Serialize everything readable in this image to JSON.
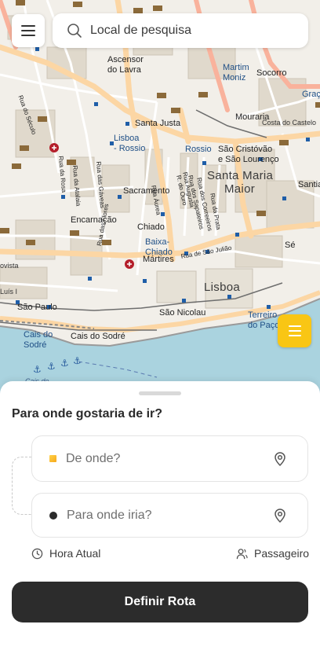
{
  "search": {
    "placeholder": "Local de pesquisa"
  },
  "icons": {
    "menu": "hamburger-icon",
    "search": "search-icon",
    "layers": "list-icon",
    "location_pin": "location-pin-icon",
    "clock": "clock-icon",
    "user": "user-icon"
  },
  "map": {
    "labels": {
      "lavra": "Lavra",
      "ascensor": "Ascensor",
      "do_lavra": "do Lavra",
      "martim": "Martim",
      "moniz": "Moniz",
      "socorro": "Socorro",
      "graca": "Graç",
      "mouraria": "Mouraria",
      "costa_castelo": "Costa do Castelo",
      "santa_justa": "Santa Justa",
      "lisboa_rossio": "Lisboa",
      "rossio": "- Rossio",
      "rossio2": "Rossio",
      "sao_cristovao": "São Cristóvão",
      "sao_lourenco": "e São Lourenço",
      "santa_maria": "Santa Maria",
      "maior": "Maior",
      "santiago": "Santia",
      "sacramento": "Sacramento",
      "encarnacao": "Encarnação",
      "chiado": "Chiado",
      "baixa": "Baixa-",
      "chiado2": "Chiado",
      "martires": "Mártires",
      "se": "Sé",
      "lisboa": "Lisboa",
      "sao_paulo": "São Paulo",
      "sao_nicolau": "São Nicolau",
      "terreiro": "Terreiro",
      "do_paco": "do Paço",
      "cais_sodre": "Cais do",
      "sodre": "Sodré",
      "cais_do_sodre": "Cais do Sodré",
      "rua_aurea": "Rua Áurea",
      "rua_augusta": "Rua Augusta",
      "rua_da_prata": "Rua da Prata",
      "rua_dos_correeiros": "Rua dos Correeiros",
      "rua_dos_sapateiros": "Rua dos Sapateiros",
      "rua_do_ouro": "R. do Ouro",
      "rua_das_gaveas": "Rua das Gáveas",
      "rua_da_rosa": "Rua da Rosa",
      "rua_do_seculo": "Rua do Século",
      "rua_das_flores": "Rua das Flores",
      "rua_sao_juliao": "Rua de São Julião",
      "rua_da_atalaia": "Rua da Atalaia",
      "luis": "Luís I",
      "avista": "ovista",
      "cais": "Cais de"
    }
  },
  "layers_button": {
    "icon": "list-icon"
  },
  "sheet": {
    "question": "Para onde gostaria de ir?",
    "from_placeholder": "De onde?",
    "to_placeholder": "Para onde iria?",
    "time_option": "Hora Atual",
    "passenger_option": "Passageiro",
    "cta": "Definir Rota"
  },
  "colors": {
    "accent": "#f9c614",
    "cta_bg": "#2c2c2c",
    "map_bg": "#f2efe9",
    "water": "#aad3df",
    "road_major": "#fcd6a4",
    "road_primary": "#f9b29c"
  }
}
